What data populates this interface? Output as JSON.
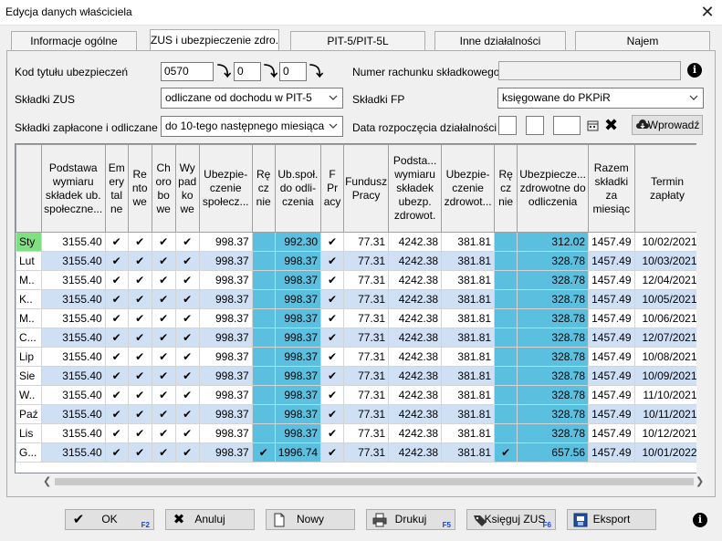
{
  "window": {
    "title": "Edycja danych właściciela"
  },
  "tabs": [
    "Informacje ogólne",
    "ZUS i ubezpieczenie zdro...",
    "PIT-5/PIT-5L",
    "Inne działalności",
    "Najem"
  ],
  "form": {
    "kod_label": "Kod tytułu ubezpieczeń",
    "kod1": "0570",
    "kod2": "0",
    "kod3": "0",
    "numer_label": "Numer rachunku składkowego",
    "numer_value": "",
    "skladki_zus_label": "Składki ZUS",
    "skladki_zus_value": "odliczane od dochodu w PIT-5",
    "skladki_fp_label": "Składki FP",
    "skladki_fp_value": "księgowane do PKPiR",
    "zaplacone_label": "Składki zapłacone i odliczane",
    "zaplacone_value": "do 10-tego następnego miesiąca",
    "data_label": "Data rozpoczęcia działalności",
    "wprowadz": "Wprowadź"
  },
  "table": {
    "headers": [
      "",
      "Podstawa wymiaru składek ub. społeczne...",
      "Em ery tal ne",
      "Re nto we",
      "Ch oro bo we",
      "Wy pad ko we",
      "Ubezpie- czenie społecz...",
      "Rę cz nie",
      "Ub.społ. do odli- czenia",
      "F Pr acy",
      "Fundusz Pracy",
      "Podsta... wymiaru składek ubezp. zdrowot.",
      "Ubezpie- czenie zdrowot...",
      "Rę cz nie",
      "Ubezpiecze... zdrowotne do odliczenia",
      "Razem składki za miesiąc",
      "Termin zapłaty"
    ],
    "rows": [
      {
        "m": "Sty",
        "p": "3155.40",
        "u": "998.37",
        "r": "",
        "o": "992.30",
        "fp": "77.31",
        "pz": "4242.38",
        "uz": "381.81",
        "rz": "",
        "z": "312.02",
        "s": "1457.49",
        "t": "10/02/2021"
      },
      {
        "m": "Lut",
        "p": "3155.40",
        "u": "998.37",
        "r": "",
        "o": "998.37",
        "fp": "77.31",
        "pz": "4242.38",
        "uz": "381.81",
        "rz": "",
        "z": "328.78",
        "s": "1457.49",
        "t": "10/03/2021"
      },
      {
        "m": "M..",
        "p": "3155.40",
        "u": "998.37",
        "r": "",
        "o": "998.37",
        "fp": "77.31",
        "pz": "4242.38",
        "uz": "381.81",
        "rz": "",
        "z": "328.78",
        "s": "1457.49",
        "t": "12/04/2021"
      },
      {
        "m": "K..",
        "p": "3155.40",
        "u": "998.37",
        "r": "",
        "o": "998.37",
        "fp": "77.31",
        "pz": "4242.38",
        "uz": "381.81",
        "rz": "",
        "z": "328.78",
        "s": "1457.49",
        "t": "10/05/2021"
      },
      {
        "m": "M..",
        "p": "3155.40",
        "u": "998.37",
        "r": "",
        "o": "998.37",
        "fp": "77.31",
        "pz": "4242.38",
        "uz": "381.81",
        "rz": "",
        "z": "328.78",
        "s": "1457.49",
        "t": "10/06/2021"
      },
      {
        "m": "C...",
        "p": "3155.40",
        "u": "998.37",
        "r": "",
        "o": "998.37",
        "fp": "77.31",
        "pz": "4242.38",
        "uz": "381.81",
        "rz": "",
        "z": "328.78",
        "s": "1457.49",
        "t": "12/07/2021"
      },
      {
        "m": "Lip",
        "p": "3155.40",
        "u": "998.37",
        "r": "",
        "o": "998.37",
        "fp": "77.31",
        "pz": "4242.38",
        "uz": "381.81",
        "rz": "",
        "z": "328.78",
        "s": "1457.49",
        "t": "10/08/2021"
      },
      {
        "m": "Sie",
        "p": "3155.40",
        "u": "998.37",
        "r": "",
        "o": "998.37",
        "fp": "77.31",
        "pz": "4242.38",
        "uz": "381.81",
        "rz": "",
        "z": "328.78",
        "s": "1457.49",
        "t": "10/09/2021"
      },
      {
        "m": "W..",
        "p": "3155.40",
        "u": "998.37",
        "r": "",
        "o": "998.37",
        "fp": "77.31",
        "pz": "4242.38",
        "uz": "381.81",
        "rz": "",
        "z": "328.78",
        "s": "1457.49",
        "t": "11/10/2021"
      },
      {
        "m": "Paź",
        "p": "3155.40",
        "u": "998.37",
        "r": "",
        "o": "998.37",
        "fp": "77.31",
        "pz": "4242.38",
        "uz": "381.81",
        "rz": "",
        "z": "328.78",
        "s": "1457.49",
        "t": "10/11/2021"
      },
      {
        "m": "Lis",
        "p": "3155.40",
        "u": "998.37",
        "r": "",
        "o": "998.37",
        "fp": "77.31",
        "pz": "4242.38",
        "uz": "381.81",
        "rz": "",
        "z": "328.78",
        "s": "1457.49",
        "t": "10/12/2021"
      },
      {
        "m": "G...",
        "p": "3155.40",
        "u": "998.37",
        "r": "✔",
        "o": "1996.74",
        "fp": "77.31",
        "pz": "4242.38",
        "uz": "381.81",
        "rz": "✔",
        "z": "657.56",
        "s": "1457.49",
        "t": "10/01/2022"
      }
    ],
    "check": "✔"
  },
  "buttons": {
    "ok": "OK",
    "ok_key": "F2",
    "anuluj": "Anuluj",
    "nowy": "Nowy",
    "drukuj": "Drukuj",
    "drukuj_key": "F5",
    "ksieguj": "Księguj ZUS",
    "ksieguj_key": "F6",
    "eksport": "Eksport"
  },
  "colors": {
    "selected_month": "#7fe07f",
    "manual_blue": "#5bc0e0",
    "alt_row": "#cfe0f4"
  }
}
